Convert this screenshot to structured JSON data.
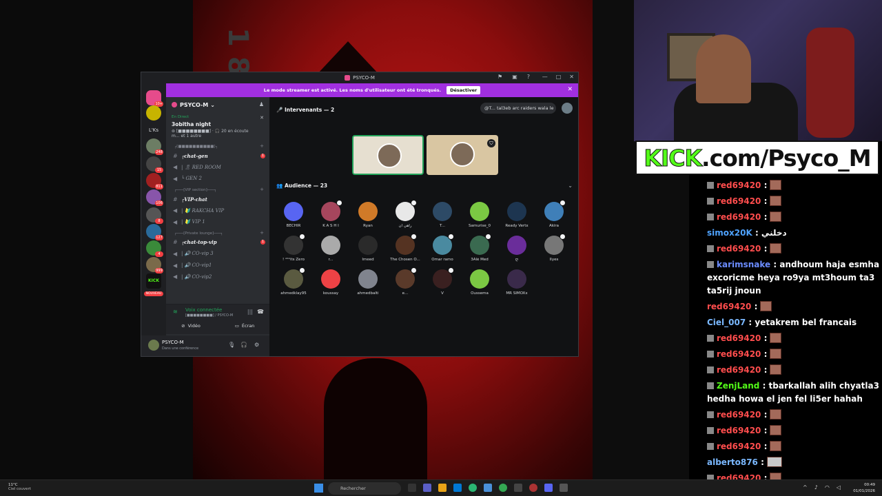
{
  "stream": {
    "kick_prefix": "KICK",
    "kick_suffix": ".com/Psyco_M"
  },
  "chat": [
    {
      "user": "red69420",
      "color": "#ff4d4d",
      "text": ":",
      "emote": true,
      "badge": true
    },
    {
      "user": "red69420",
      "color": "#ff4d4d",
      "text": ":",
      "emote": true,
      "badge": true
    },
    {
      "user": "red69420",
      "color": "#ff4d4d",
      "text": ":",
      "emote": true,
      "badge": true
    },
    {
      "user": "simox20K",
      "color": "#4fa3ff",
      "text": ": دخلني",
      "emote": false,
      "badge": false
    },
    {
      "user": "red69420",
      "color": "#ff4d4d",
      "text": ":",
      "emote": true,
      "badge": true
    },
    {
      "user": "karimsnake",
      "color": "#6b8cff",
      "text": ": andhoum haja esmha excoricme heya ro9ya mt3houm ta3 ta5rij jnoun",
      "emote": false,
      "badge": true
    },
    {
      "user": "red69420",
      "color": "#ff4d4d",
      "text": ":",
      "emote": true,
      "badge": false
    },
    {
      "user": "Ciel_007",
      "color": "#7ab8ff",
      "text": ": yetakrem bel francais",
      "emote": false,
      "badge": false
    },
    {
      "user": "red69420",
      "color": "#ff4d4d",
      "text": ":",
      "emote": true,
      "badge": true
    },
    {
      "user": "red69420",
      "color": "#ff4d4d",
      "text": ":",
      "emote": true,
      "badge": true
    },
    {
      "user": "red69420",
      "color": "#ff4d4d",
      "text": ":",
      "emote": true,
      "badge": true
    },
    {
      "user": "ZenjLand",
      "color": "#53fc18",
      "text": ": tbarkallah alih chyatla3 hedha howa el jen fel li5er hahah",
      "emote": false,
      "badge": true
    },
    {
      "user": "red69420",
      "color": "#ff4d4d",
      "text": ":",
      "emote": true,
      "badge": true
    },
    {
      "user": "red69420",
      "color": "#ff4d4d",
      "text": ":",
      "emote": true,
      "badge": true
    },
    {
      "user": "red69420",
      "color": "#ff4d4d",
      "text": ":",
      "emote": true,
      "badge": true
    },
    {
      "user": "alberto876",
      "color": "#7ab8ff",
      "text": ":",
      "emote": true,
      "emote_kind": "cat",
      "badge": false
    },
    {
      "user": "red69420",
      "color": "#ff4d4d",
      "text": ":",
      "emote": true,
      "badge": true
    },
    {
      "user": "red69420",
      "color": "#ff4d4d",
      "text": ":",
      "emote": true,
      "badge": true
    }
  ],
  "discord": {
    "window_title": "PSYCO-M",
    "streamer_notice": "Le mode streamer est activé. Les noms d'utilisateur ont été tronqués.",
    "streamer_dismiss": "Désactiver",
    "server_name": "PSYCO-M",
    "guild_label": "L'Ks",
    "guild_new": "NOUVEAU",
    "event": {
      "live": "En Direct",
      "name": "3obitha night",
      "line1": "20 en écoute",
      "line2": "m... et 1 autre"
    },
    "categories": [
      {
        "name": "┌[■■■■■■■■■■]┐"
      },
      {
        "name": "┌───[VIP section]───┐"
      },
      {
        "name": "┌───[Private lounge]───┐"
      }
    ],
    "channels_a": [
      {
        "name": "┌chat-gen",
        "unread": true,
        "mention": "1",
        "icon": "#"
      },
      {
        "name": "| 🎗 RED ROOM",
        "unread": false,
        "icon": "🔊"
      },
      {
        "name": "└ GEN 2",
        "unread": false,
        "icon": "🔊"
      }
    ],
    "channels_b": [
      {
        "name": "┌VIP-chat",
        "unread": true,
        "icon": "#"
      },
      {
        "name": "| 🔰 RAKCHA VIP",
        "unread": false,
        "icon": "🔊"
      },
      {
        "name": "| 🔰 VIP 1",
        "unread": false,
        "icon": "🔊"
      }
    ],
    "channels_c": [
      {
        "name": "┌chat-top-vip",
        "unread": true,
        "mention": "1",
        "icon": "#"
      },
      {
        "name": "| 🔊 CO-vip 3",
        "unread": false,
        "icon": "🔊"
      },
      {
        "name": "| 🔊 CO-vip1",
        "unread": false,
        "icon": "🔊"
      },
      {
        "name": "| 🔊 CO-vip2",
        "unread": false,
        "icon": "🔊"
      }
    ],
    "voice": {
      "status": "Voix connectée",
      "sub": "[■■■■■■■■] / PSYCO-M",
      "video": "Vidéo",
      "screen": "Écran"
    },
    "user": {
      "name": "PSYCO-M",
      "status": "Dans une conférence"
    },
    "stage": {
      "speakers": "Intervenants — 2",
      "topic": "@T... tal3eb arc raiders wala le",
      "audience": "Audience — 23"
    },
    "audience": [
      {
        "name": "BECHIR",
        "color": "#5865f2",
        "hand": false
      },
      {
        "name": "K A S H I",
        "color": "#a6465d",
        "hand": true
      },
      {
        "name": "Ryan",
        "color": "#d07a28",
        "hand": false
      },
      {
        "name": "راهي ان",
        "color": "#e8e8e8",
        "hand": true
      },
      {
        "name": "T...",
        "color": "#2d4a66",
        "hand": false
      },
      {
        "name": "Samurise_0",
        "color": "#7bc843",
        "hand": false
      },
      {
        "name": "Ready Vertx",
        "color": "#1d3550",
        "hand": false
      },
      {
        "name": "Akira",
        "color": "#3f7fb8",
        "hand": true
      },
      {
        "name": "! ᴬᴷᴬits Zero",
        "color": "#333333",
        "hand": true
      },
      {
        "name": "r...",
        "color": "#aaaaaa",
        "hand": false
      },
      {
        "name": "Imeed",
        "color": "#2a2a2a",
        "hand": false
      },
      {
        "name": "The Chosen O...",
        "color": "#553322",
        "hand": true
      },
      {
        "name": "Omar ramo",
        "color": "#4a8aa0",
        "hand": true
      },
      {
        "name": "3Alé Med",
        "color": "#3a6a50",
        "hand": true
      },
      {
        "name": "ღ",
        "color": "#6a2d9a",
        "hand": false
      },
      {
        "name": "Ilyes",
        "color": "#777777",
        "hand": true
      },
      {
        "name": "ahmedklay95",
        "color": "#5a5a40",
        "hand": true
      },
      {
        "name": "koussay",
        "color": "#ed4245",
        "hand": false
      },
      {
        "name": "ahmedbalti",
        "color": "#80848e",
        "hand": false
      },
      {
        "name": "e...",
        "color": "#5a3a2a",
        "hand": true
      },
      {
        "name": "V",
        "color": "#3a2020",
        "hand": true
      },
      {
        "name": "Oussema",
        "color": "#7bc843",
        "hand": false
      },
      {
        "name": "MR SIMOXx",
        "color": "#3a2a4a",
        "hand": false
      }
    ]
  },
  "taskbar": {
    "temp": "11°C",
    "weather": "Ciel couvert",
    "search": "Rechercher",
    "time": "00:49",
    "date": "01/01/2026"
  }
}
